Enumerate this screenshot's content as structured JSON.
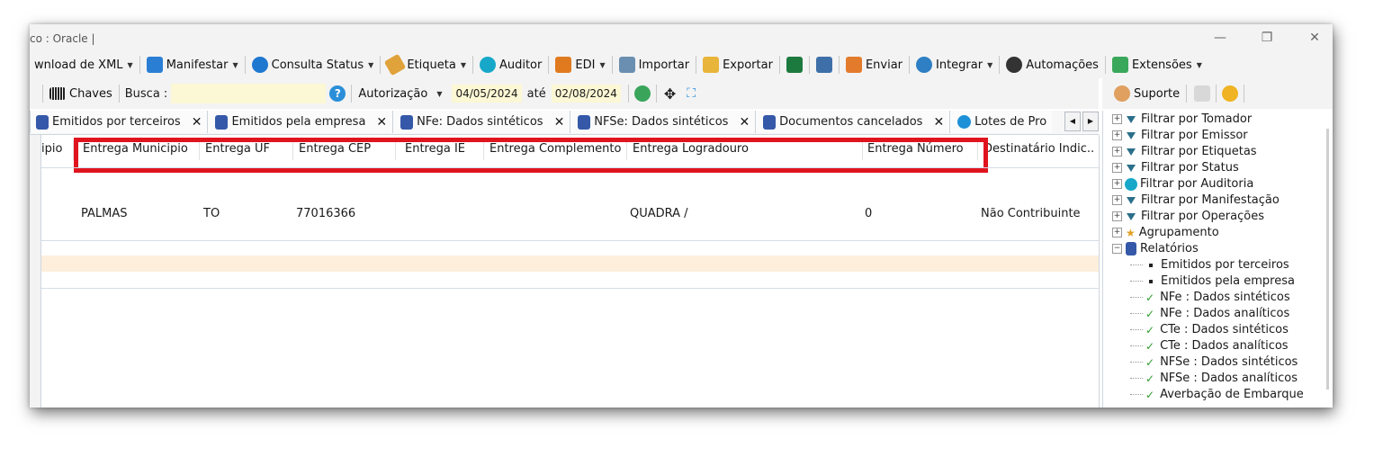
{
  "window": {
    "title": "co : Oracle |"
  },
  "toolbar": {
    "items": [
      {
        "label": "wnload de XML",
        "dropdown": true
      },
      {
        "label": "Manifestar",
        "dropdown": true
      },
      {
        "label": "Consulta Status",
        "dropdown": true
      },
      {
        "label": "Etiqueta",
        "dropdown": true
      },
      {
        "label": "Auditor",
        "dropdown": false
      },
      {
        "label": "EDI",
        "dropdown": true
      },
      {
        "label": "Importar",
        "dropdown": false
      },
      {
        "label": "Exportar",
        "dropdown": false
      },
      {
        "label": "Enviar",
        "dropdown": false
      },
      {
        "label": "Integrar",
        "dropdown": true
      },
      {
        "label": "Automações",
        "dropdown": false
      },
      {
        "label": "Extensões",
        "dropdown": true
      }
    ]
  },
  "filterbar": {
    "chaves_label": "Chaves",
    "busca_label": "Busca :",
    "busca_value": "",
    "mode": "Autorização",
    "date_from": "04/05/2024",
    "ate_label": "até",
    "date_to": "02/08/2024"
  },
  "right_top": {
    "suporte_label": "Suporte"
  },
  "tabs": [
    {
      "label": "Emitidos por terceiros"
    },
    {
      "label": "Emitidos pela empresa"
    },
    {
      "label": "NFe: Dados sintéticos"
    },
    {
      "label": "NFSe: Dados sintéticos"
    },
    {
      "label": "Documentos cancelados"
    },
    {
      "label": "Lotes de Pro"
    }
  ],
  "grid": {
    "columns": [
      "ipio",
      "Entrega Municipio",
      "Entrega UF",
      "Entrega CEP",
      "Entrega IE",
      "Entrega Complemento",
      "Entrega Logradouro",
      "Entrega Número",
      "Destinatário Indic.."
    ],
    "row": [
      "",
      "PALMAS",
      "TO",
      "77016366",
      "",
      "",
      "QUADRA /",
      "0",
      "Não Contribuinte"
    ]
  },
  "tree": {
    "filters": [
      "Filtrar por Tomador",
      "Filtrar por Emissor",
      "Filtrar por Etiquetas",
      "Filtrar por Status",
      "Filtrar por Auditoria",
      "Filtrar por Manifestação",
      "Filtrar por Operações"
    ],
    "agrupamento": "Agrupamento",
    "relatorios": "Relatórios",
    "reports": [
      {
        "label": "Emitidos por terceiros",
        "marker": "bullet"
      },
      {
        "label": "Emitidos pela empresa",
        "marker": "bullet"
      },
      {
        "label": "NFe : Dados sintéticos",
        "marker": "check"
      },
      {
        "label": "NFe : Dados analíticos",
        "marker": "check"
      },
      {
        "label": "CTe : Dados sintéticos",
        "marker": "check"
      },
      {
        "label": "CTe : Dados analíticos",
        "marker": "check"
      },
      {
        "label": "NFSe : Dados sintéticos",
        "marker": "check"
      },
      {
        "label": "NFSe : Dados analíticos",
        "marker": "check"
      },
      {
        "label": "Averbação de Embarque",
        "marker": "check"
      }
    ]
  },
  "colors": {
    "highlight": "#e0141e",
    "input_bg": "#fcf7d4",
    "row_highlight": "#fdefdc"
  }
}
